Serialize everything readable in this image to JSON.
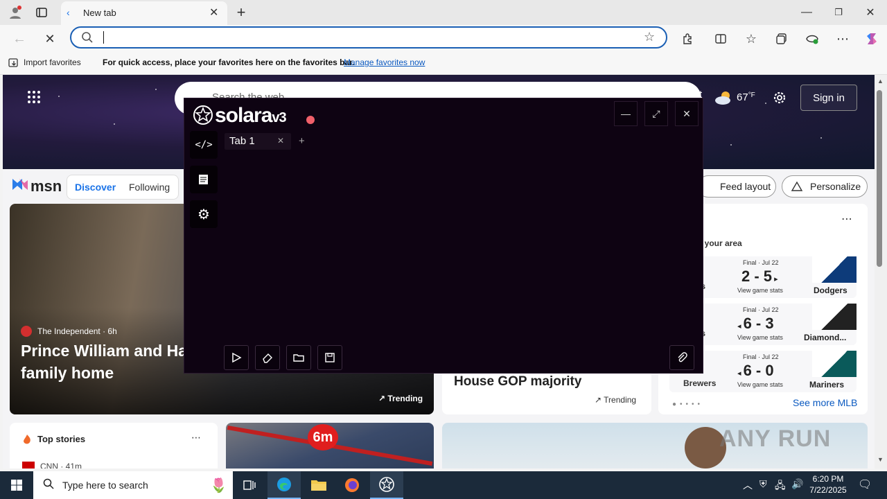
{
  "browser": {
    "tab_title": "New tab",
    "address_value": "",
    "favbar": {
      "import_label": "Import favorites",
      "message": "For quick access, place your favorites here on the favorites bar.",
      "manage_link": "Manage favorites now"
    }
  },
  "msn": {
    "search_placeholder": "Search the web",
    "weather_temp": "67",
    "weather_unit": "°F",
    "sign_in": "Sign in",
    "logo_text": "msn",
    "tabs": [
      "Discover",
      "Following"
    ],
    "feed_layout": "Feed layout",
    "personalize": "Personalize",
    "hero_story": {
      "source": "The Independent",
      "age": "6h",
      "headline_line1": "Prince William and Ha",
      "headline_line2": "family home",
      "trending": "Trending"
    },
    "middle_story": {
      "headline": "House GOP majority",
      "trending": "Trending"
    },
    "sports": {
      "in_your_area": "n your area",
      "games": [
        {
          "status": "Final · Jul 22",
          "score": "2 - 5",
          "arrow": "right",
          "stats": "View game stats",
          "home_abbr": "ns",
          "away": "Dodgers"
        },
        {
          "status": "Final · Jul 22",
          "score": "6 - 3",
          "arrow": "left",
          "stats": "View game stats",
          "home_abbr": "os",
          "away": "Diamond..."
        },
        {
          "status": "Final · Jul 22",
          "score": "6 - 0",
          "arrow": "left",
          "stats": "View game stats",
          "home_abbr": "Brewers",
          "away": "Mariners"
        }
      ],
      "see_more": "See more MLB"
    },
    "top_stories": {
      "title": "Top stories",
      "source": "CNN · 41m"
    },
    "video_badge": "6m",
    "watermark": "ANY RUN"
  },
  "solara": {
    "title": "solara",
    "version": "v3",
    "tab_label": "Tab 1",
    "add_tab": "+",
    "status_color": "#f0606a"
  },
  "taskbar": {
    "search_placeholder": "Type here to search",
    "time": "6:20 PM",
    "date": "7/22/2025"
  }
}
